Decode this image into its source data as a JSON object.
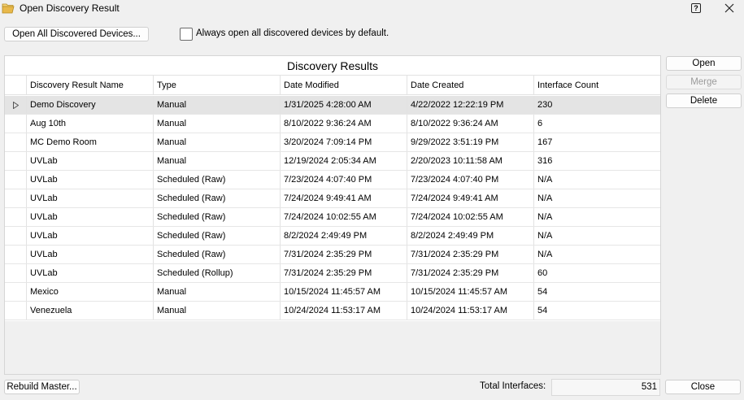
{
  "window": {
    "title": "Open Discovery Result",
    "help_label": "?"
  },
  "toolbar": {
    "open_all_label": "Open All Discovered Devices...",
    "always_open_label": "Always open all discovered devices by default.",
    "always_open_checked": false
  },
  "grid": {
    "title": "Discovery Results",
    "columns": [
      "Discovery Result Name",
      "Type",
      "Date Modified",
      "Date Created",
      "Interface Count"
    ],
    "rows": [
      [
        "Demo Discovery",
        "Manual",
        "1/31/2025 4:28:00 AM",
        "4/22/2022 12:22:19 PM",
        "230"
      ],
      [
        "Aug 10th",
        "Manual",
        "8/10/2022 9:36:24 AM",
        "8/10/2022 9:36:24 AM",
        "6"
      ],
      [
        "MC Demo Room",
        "Manual",
        "3/20/2024 7:09:14 PM",
        "9/29/2022 3:51:19 PM",
        "167"
      ],
      [
        "UVLab",
        "Manual",
        "12/19/2024 2:05:34 AM",
        "2/20/2023 10:11:58 AM",
        "316"
      ],
      [
        "UVLab",
        "Scheduled (Raw)",
        "7/23/2024 4:07:40 PM",
        "7/23/2024 4:07:40 PM",
        "N/A"
      ],
      [
        "UVLab",
        "Scheduled (Raw)",
        "7/24/2024 9:49:41 AM",
        "7/24/2024 9:49:41 AM",
        "N/A"
      ],
      [
        "UVLab",
        "Scheduled (Raw)",
        "7/24/2024 10:02:55 AM",
        "7/24/2024 10:02:55 AM",
        "N/A"
      ],
      [
        "UVLab",
        "Scheduled (Raw)",
        "8/2/2024 2:49:49 PM",
        "8/2/2024 2:49:49 PM",
        "N/A"
      ],
      [
        "UVLab",
        "Scheduled (Raw)",
        "7/31/2024 2:35:29 PM",
        "7/31/2024 2:35:29 PM",
        "N/A"
      ],
      [
        "UVLab",
        "Scheduled (Rollup)",
        "7/31/2024 2:35:29 PM",
        "7/31/2024 2:35:29 PM",
        "60"
      ],
      [
        "Mexico",
        "Manual",
        "10/15/2024 11:45:57 AM",
        "10/15/2024 11:45:57 AM",
        "54"
      ],
      [
        "Venezuela",
        "Manual",
        "10/24/2024 11:53:17 AM",
        "10/24/2024 11:53:17 AM",
        "54"
      ]
    ],
    "selected_row": 0
  },
  "side_buttons": {
    "open_label": "Open",
    "merge_label": "Merge",
    "delete_label": "Delete"
  },
  "footer": {
    "rebuild_label": "Rebuild Master...",
    "total_label": "Total Interfaces:",
    "total_value": "531",
    "close_label": "Close"
  },
  "icons": {
    "window": "folder-open-icon",
    "help": "help-icon",
    "close": "close-icon",
    "row_indicator": "row-pointer-icon"
  },
  "colors": {
    "window_bg": "#f0f0f0",
    "selected_row": "#e4e4e4",
    "folder_icon": "#e8b84a"
  }
}
